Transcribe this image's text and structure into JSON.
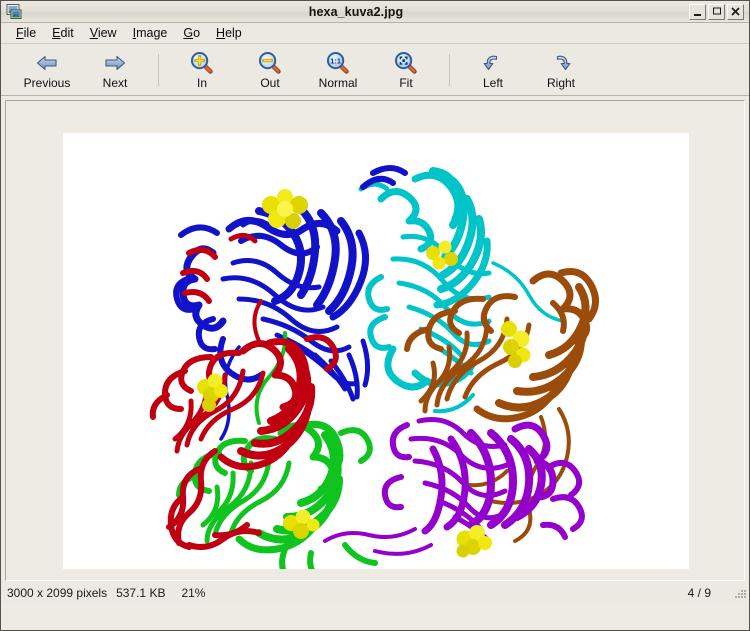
{
  "window": {
    "title": "hexa_kuva2.jpg",
    "app_icon": "image-viewer-icon",
    "controls": {
      "minimize_label": "–",
      "maximize_label": "□",
      "close_label": "✕"
    }
  },
  "menubar": {
    "items": [
      {
        "label": "File",
        "mnemonic": "F"
      },
      {
        "label": "Edit",
        "mnemonic": "E"
      },
      {
        "label": "View",
        "mnemonic": "V"
      },
      {
        "label": "Image",
        "mnemonic": "I"
      },
      {
        "label": "Go",
        "mnemonic": "G"
      },
      {
        "label": "Help",
        "mnemonic": "H"
      }
    ]
  },
  "toolbar": {
    "groups": [
      {
        "buttons": [
          {
            "label": "Previous",
            "icon": "arrow-left-icon"
          },
          {
            "label": "Next",
            "icon": "arrow-right-icon"
          }
        ]
      },
      {
        "buttons": [
          {
            "label": "In",
            "icon": "zoom-in-icon",
            "lens": "+"
          },
          {
            "label": "Out",
            "icon": "zoom-out-icon",
            "lens": "−"
          },
          {
            "label": "Normal",
            "icon": "zoom-normal-icon",
            "lens": "1:1"
          },
          {
            "label": "Fit",
            "icon": "zoom-fit-icon",
            "lens": "⤡"
          }
        ]
      },
      {
        "buttons": [
          {
            "label": "Left",
            "icon": "rotate-left-icon"
          },
          {
            "label": "Right",
            "icon": "rotate-right-icon"
          }
        ]
      }
    ]
  },
  "statusbar": {
    "dimensions": "3000 x 2099 pixels",
    "filesize": "537.1 KB",
    "zoom": "21%",
    "page": "4 / 9",
    "grip": "resize-grip-icon"
  },
  "image": {
    "alt": "Protein hexamer ribbon diagram",
    "background": "#ffffff",
    "subunits": [
      {
        "name": "blue",
        "color": "#1212c8",
        "position": "top-left"
      },
      {
        "name": "cyan",
        "color": "#00c4c8",
        "position": "top-right"
      },
      {
        "name": "brown",
        "color": "#9c4c0a",
        "position": "right"
      },
      {
        "name": "purple",
        "color": "#9400cc",
        "position": "bottom-right"
      },
      {
        "name": "green",
        "color": "#10c420",
        "position": "bottom-left"
      },
      {
        "name": "red",
        "color": "#c00010",
        "position": "left"
      }
    ],
    "ligand_color": "#e8e000"
  },
  "theme": {
    "window_bg": "#eceae3",
    "toolbar_bg": "#ece9e2",
    "viewport_bg": "#edebe4",
    "text": "#101010"
  }
}
